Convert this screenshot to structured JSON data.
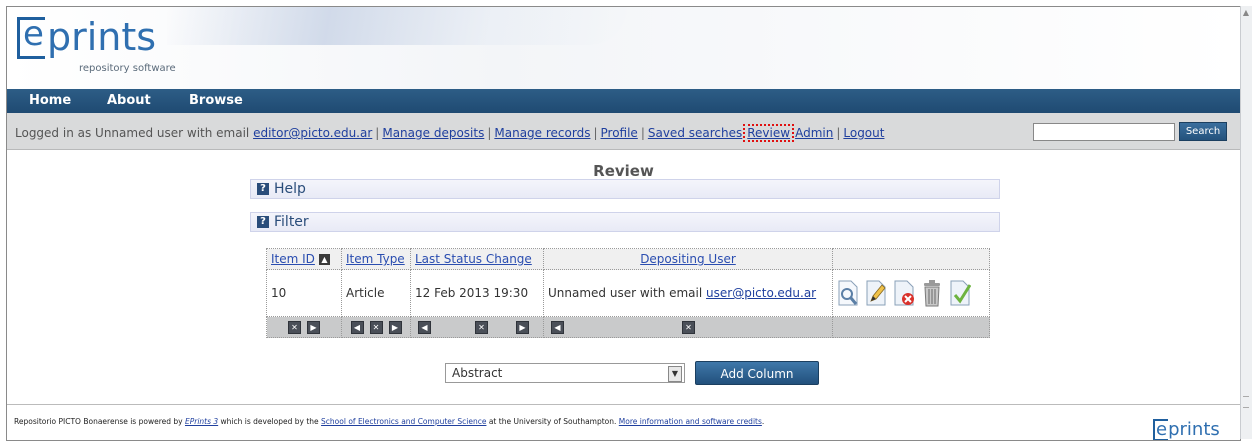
{
  "header": {
    "logo_letter": "e",
    "logo_text": "prints",
    "logo_subtitle": "repository software"
  },
  "nav": {
    "items": [
      "Home",
      "About",
      "Browse"
    ]
  },
  "userbar": {
    "prefix": "Logged in as Unnamed user with email ",
    "email": "editor@picto.edu.ar",
    "links": [
      "Manage deposits",
      "Manage records",
      "Profile",
      "Saved searches",
      "Review",
      "Admin",
      "Logout"
    ],
    "separator": "|",
    "search_value": "",
    "search_button": "Search"
  },
  "page": {
    "title": "Review",
    "sections": [
      "Help",
      "Filter"
    ],
    "section_icon": "?"
  },
  "table": {
    "headers": [
      "Item ID",
      "Item Type",
      "Last Status Change",
      "Depositing User",
      ""
    ],
    "sort_indicator": "▲",
    "rows": [
      {
        "item_id": "10",
        "item_type": "Article",
        "last_status_change": "12 Feb 2013 19:30",
        "depositing_user_prefix": "Unnamed user with email ",
        "depositing_user_email": "user@picto.edu.ar",
        "actions": [
          "view-icon",
          "edit-icon",
          "remove-icon",
          "delete-icon",
          "accept-icon"
        ]
      }
    ]
  },
  "add_column": {
    "selected": "Abstract",
    "button": "Add Column"
  },
  "footer": {
    "text1": "Repositorio PICTO Bonaerense is powered by ",
    "link1": "EPrints 3",
    "text2": " which is developed by the ",
    "link2": "School of Electronics and Computer Science",
    "text3": " at the University of Southampton. ",
    "link3": "More information and software credits",
    "text4": ".",
    "logo_letter": "e",
    "logo_text": "prints"
  },
  "colors": {
    "nav_bg": "#1f4a72",
    "link": "#1f3f9e",
    "highlight_box": "#e01010",
    "logo_blue": "#2f6fb0"
  }
}
